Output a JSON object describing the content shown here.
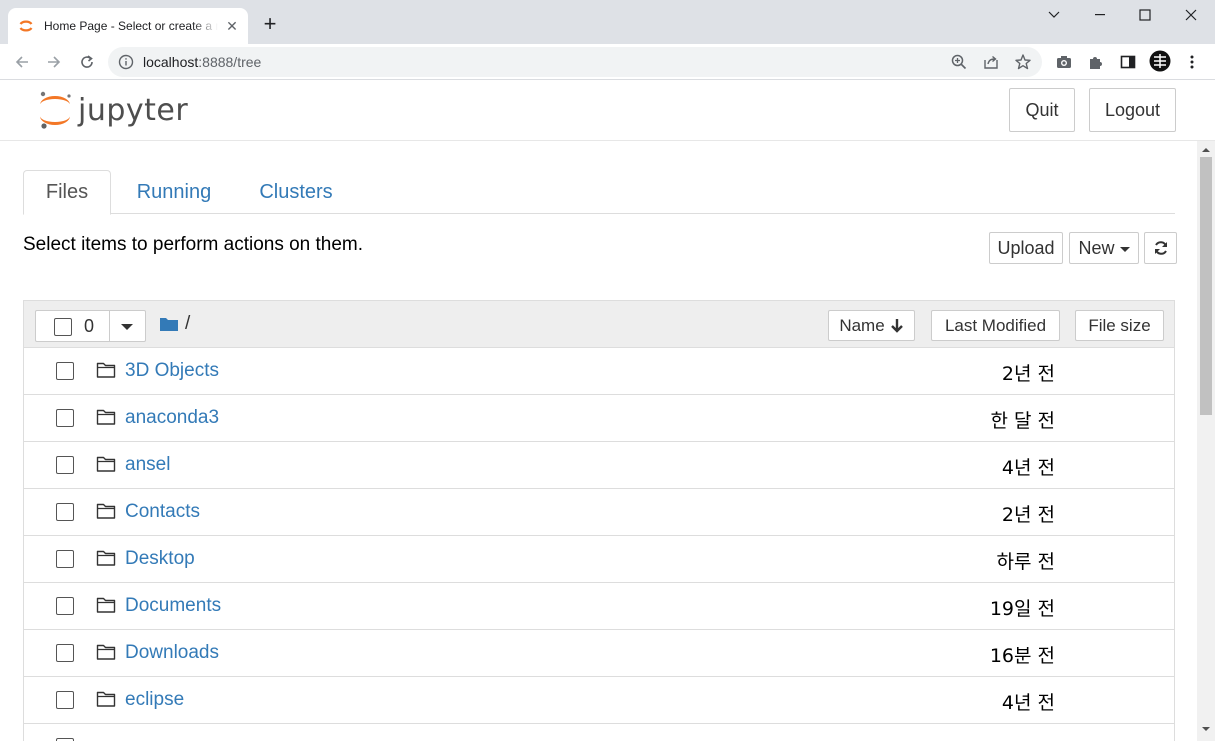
{
  "browser": {
    "tab_title": "Home Page - Select or create a notebook",
    "url_host": "localhost",
    "url_path": ":8888/tree"
  },
  "header": {
    "logo_text": "jupyter",
    "quit_label": "Quit",
    "logout_label": "Logout"
  },
  "tabs": [
    {
      "label": "Files",
      "active": true
    },
    {
      "label": "Running",
      "active": false
    },
    {
      "label": "Clusters",
      "active": false
    }
  ],
  "instructions": "Select items to perform actions on them.",
  "actions": {
    "upload_label": "Upload",
    "new_label": "New"
  },
  "list_header": {
    "selected_count": "0",
    "breadcrumb": "/",
    "sort_name_label": "Name",
    "sort_modified_label": "Last Modified",
    "sort_size_label": "File size"
  },
  "files": [
    {
      "name": "3D Objects",
      "modified": "2년 전"
    },
    {
      "name": "anaconda3",
      "modified": "한 달 전"
    },
    {
      "name": "ansel",
      "modified": "4년 전"
    },
    {
      "name": "Contacts",
      "modified": "2년 전"
    },
    {
      "name": "Desktop",
      "modified": "하루 전"
    },
    {
      "name": "Documents",
      "modified": "19일 전"
    },
    {
      "name": "Downloads",
      "modified": "16분 전"
    },
    {
      "name": "eclipse",
      "modified": "4년 전"
    }
  ],
  "colors": {
    "link": "#337ab7",
    "jupyter_orange": "#f37726",
    "folder_blue": "#337ab7"
  }
}
